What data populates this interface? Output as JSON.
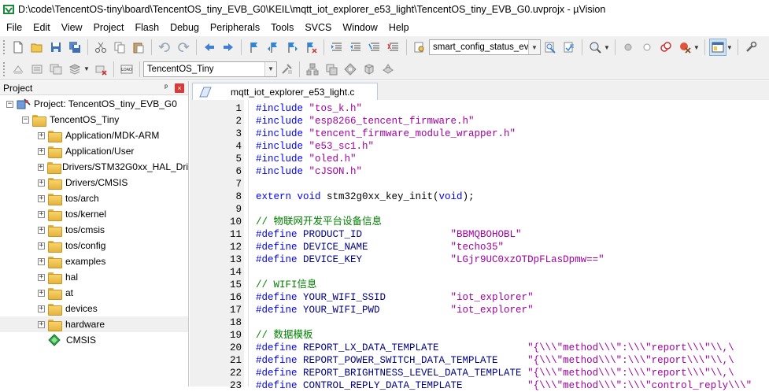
{
  "window": {
    "title": "D:\\code\\TencentOS-tiny\\board\\TencentOS_tiny_EVB_G0\\KEIL\\mqtt_iot_explorer_e53_light\\TencentOS_tiny_EVB_G0.uvprojx - µVision"
  },
  "menu": [
    "File",
    "Edit",
    "View",
    "Project",
    "Flash",
    "Debug",
    "Peripherals",
    "Tools",
    "SVCS",
    "Window",
    "Help"
  ],
  "toolbar": {
    "find_combo_value": "smart_config_status_ever",
    "target_combo_value": "TencentOS_Tiny",
    "load_label": "LOAD"
  },
  "project_panel": {
    "title": "Project",
    "pin_glyph": "ᵖ",
    "close_glyph": "×",
    "root": "Project: TencentOS_tiny_EVB_G0",
    "target": "TencentOS_Tiny",
    "groups": [
      "Application/MDK-ARM",
      "Application/User",
      "Drivers/STM32G0xx_HAL_Dri",
      "Drivers/CMSIS",
      "tos/arch",
      "tos/kernel",
      "tos/cmsis",
      "tos/config",
      "examples",
      "hal",
      "at",
      "devices",
      "hardware",
      "CMSIS"
    ]
  },
  "editor": {
    "active_tab": "mqtt_iot_explorer_e53_light.c",
    "lines": [
      {
        "n": "1",
        "parts": [
          {
            "t": "#include ",
            "c": "pp"
          },
          {
            "t": "\"tos_k.h\"",
            "c": "str"
          }
        ]
      },
      {
        "n": "2",
        "parts": [
          {
            "t": "#include ",
            "c": "pp"
          },
          {
            "t": "\"esp8266_tencent_firmware.h\"",
            "c": "str"
          }
        ]
      },
      {
        "n": "3",
        "parts": [
          {
            "t": "#include ",
            "c": "pp"
          },
          {
            "t": "\"tencent_firmware_module_wrapper.h\"",
            "c": "str"
          }
        ]
      },
      {
        "n": "4",
        "parts": [
          {
            "t": "#include ",
            "c": "pp"
          },
          {
            "t": "\"e53_sc1.h\"",
            "c": "str"
          }
        ]
      },
      {
        "n": "5",
        "parts": [
          {
            "t": "#include ",
            "c": "pp"
          },
          {
            "t": "\"oled.h\"",
            "c": "str"
          }
        ]
      },
      {
        "n": "6",
        "parts": [
          {
            "t": "#include ",
            "c": "pp"
          },
          {
            "t": "\"cJSON.h\"",
            "c": "str"
          }
        ]
      },
      {
        "n": "7",
        "parts": []
      },
      {
        "n": "8",
        "parts": [
          {
            "t": "extern void ",
            "c": "pp"
          },
          {
            "t": "stm32g0xx_key_init(",
            "c": "fn"
          },
          {
            "t": "void",
            "c": "pp"
          },
          {
            "t": ");",
            "c": "fn"
          }
        ]
      },
      {
        "n": "9",
        "parts": []
      },
      {
        "n": "10",
        "parts": [
          {
            "t": "// 物联网开发平台设备信息",
            "c": "cmt"
          }
        ]
      },
      {
        "n": "11",
        "parts": [
          {
            "t": "#define ",
            "c": "pp"
          },
          {
            "t": "PRODUCT_ID               ",
            "c": "id"
          },
          {
            "t": "\"BBMQBOHOBL\"",
            "c": "str"
          }
        ]
      },
      {
        "n": "12",
        "parts": [
          {
            "t": "#define ",
            "c": "pp"
          },
          {
            "t": "DEVICE_NAME              ",
            "c": "id"
          },
          {
            "t": "\"techo35\"",
            "c": "str"
          }
        ]
      },
      {
        "n": "13",
        "parts": [
          {
            "t": "#define ",
            "c": "pp"
          },
          {
            "t": "DEVICE_KEY               ",
            "c": "id"
          },
          {
            "t": "\"LGjr9UC0xzOTDpFLasDpmw==\"",
            "c": "str"
          }
        ]
      },
      {
        "n": "14",
        "parts": []
      },
      {
        "n": "15",
        "parts": [
          {
            "t": "// WIFI信息",
            "c": "cmt"
          }
        ]
      },
      {
        "n": "16",
        "parts": [
          {
            "t": "#define ",
            "c": "pp"
          },
          {
            "t": "YOUR_WIFI_SSID           ",
            "c": "id"
          },
          {
            "t": "\"iot_explorer\"",
            "c": "str"
          }
        ]
      },
      {
        "n": "17",
        "parts": [
          {
            "t": "#define ",
            "c": "pp"
          },
          {
            "t": "YOUR_WIFI_PWD            ",
            "c": "id"
          },
          {
            "t": "\"iot_explorer\"",
            "c": "str"
          }
        ]
      },
      {
        "n": "18",
        "parts": []
      },
      {
        "n": "19",
        "parts": [
          {
            "t": "// 数据模板",
            "c": "cmt"
          }
        ]
      },
      {
        "n": "20",
        "parts": [
          {
            "t": "#define ",
            "c": "pp"
          },
          {
            "t": "REPORT_LX_DATA_TEMPLATE               ",
            "c": "id"
          },
          {
            "t": "\"{\\\\\\\"method\\\\\\\":\\\\\\\"report\\\\\\\"\\\\,\\",
            "c": "str"
          }
        ]
      },
      {
        "n": "21",
        "parts": [
          {
            "t": "#define ",
            "c": "pp"
          },
          {
            "t": "REPORT_POWER_SWITCH_DATA_TEMPLATE     ",
            "c": "id"
          },
          {
            "t": "\"{\\\\\\\"method\\\\\\\":\\\\\\\"report\\\\\\\"\\\\,\\",
            "c": "str"
          }
        ]
      },
      {
        "n": "22",
        "parts": [
          {
            "t": "#define ",
            "c": "pp"
          },
          {
            "t": "REPORT_BRIGHTNESS_LEVEL_DATA_TEMPLATE ",
            "c": "id"
          },
          {
            "t": "\"{\\\\\\\"method\\\\\\\":\\\\\\\"report\\\\\\\"\\\\,\\",
            "c": "str"
          }
        ]
      },
      {
        "n": "23",
        "parts": [
          {
            "t": "#define ",
            "c": "pp"
          },
          {
            "t": "CONTROL_REPLY_DATA_TEMPLATE           ",
            "c": "id"
          },
          {
            "t": "\"{\\\\\\\"method\\\\\\\":\\\\\\\"control_reply\\\\\\\"",
            "c": "str"
          }
        ]
      }
    ]
  }
}
